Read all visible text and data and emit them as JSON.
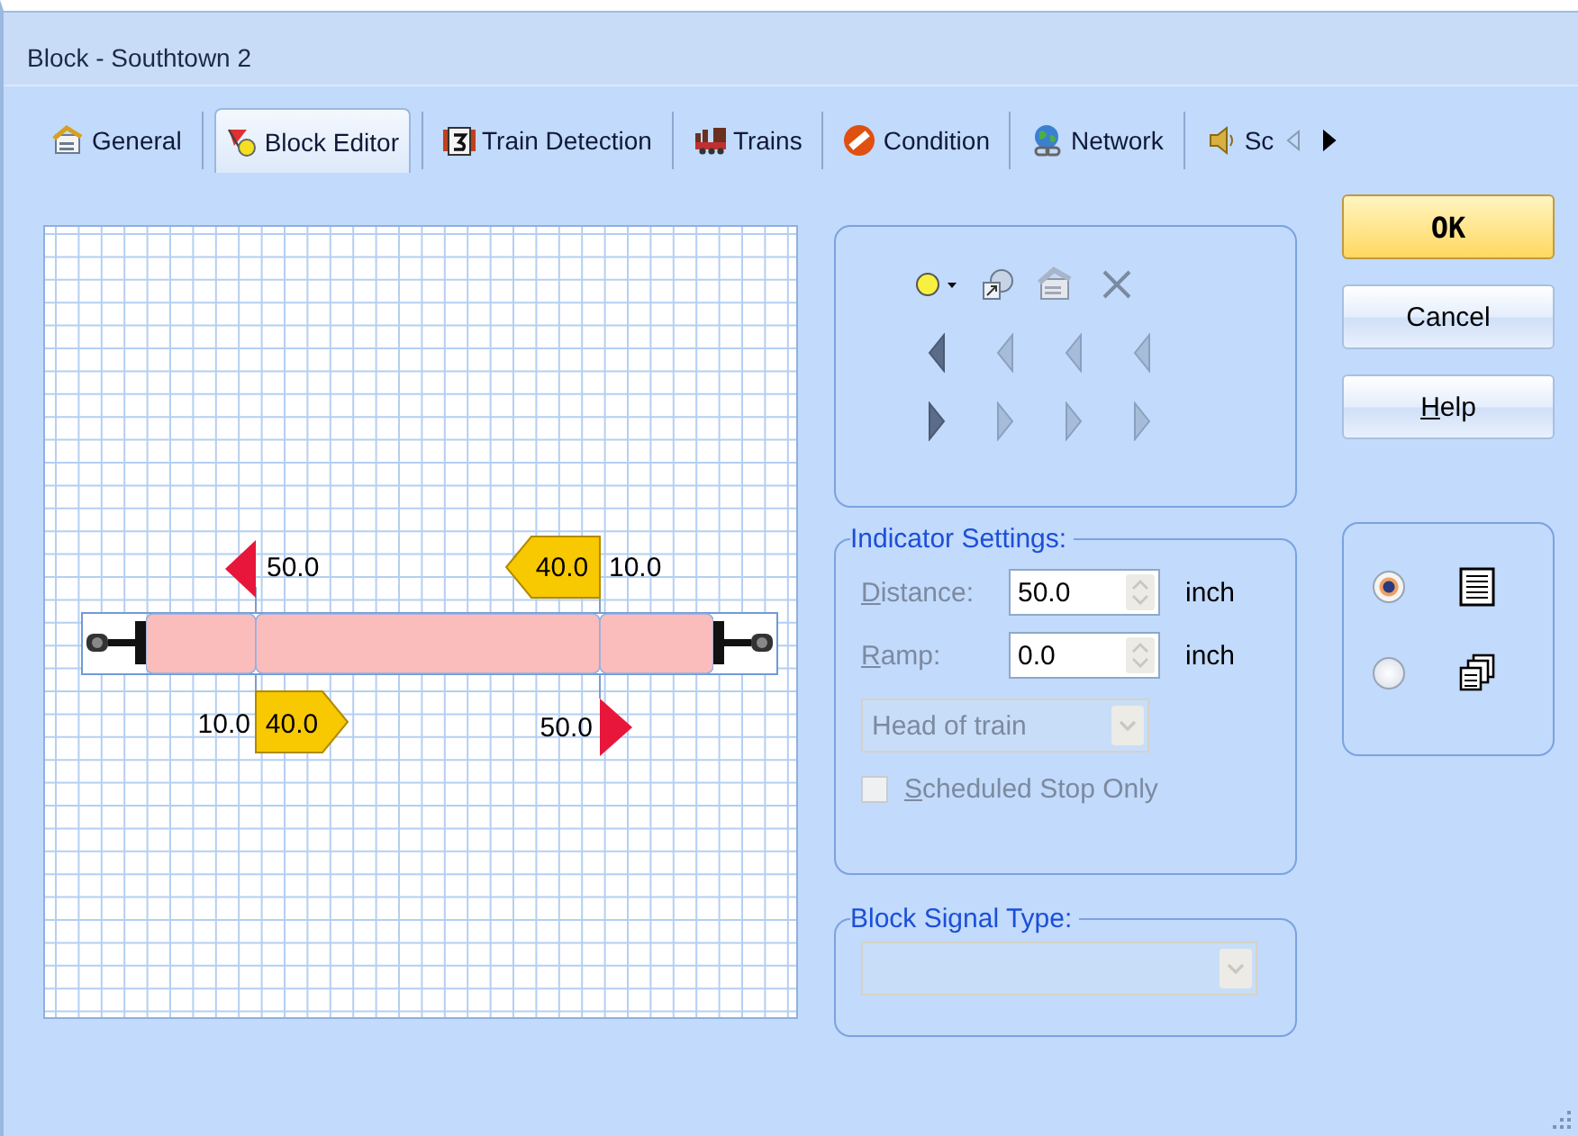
{
  "window": {
    "title": "Block - Southtown 2"
  },
  "tabs": [
    {
      "label": "General",
      "selected": false
    },
    {
      "label": "Block Editor",
      "selected": true
    },
    {
      "label": "Train Detection",
      "selected": false
    },
    {
      "label": "Trains",
      "selected": false
    },
    {
      "label": "Condition",
      "selected": false
    },
    {
      "label": "Network",
      "selected": false
    },
    {
      "label": "Sc",
      "selected": false
    }
  ],
  "tab_scroll": {
    "left_disabled": true,
    "right_disabled": false
  },
  "diagram": {
    "indicators": [
      {
        "kind": "stop",
        "below": false,
        "distance": "50.0"
      },
      {
        "kind": "speed",
        "below": false,
        "speed": "40.0",
        "distance": "10.0"
      },
      {
        "kind": "speed",
        "below": true,
        "speed": "40.0",
        "distance": "10.0"
      },
      {
        "kind": "stop",
        "below": true,
        "distance": "50.0"
      }
    ]
  },
  "toolbox": {
    "left_arrows": [
      {
        "disabled": false
      },
      {
        "disabled": true
      },
      {
        "disabled": true
      },
      {
        "disabled": true
      }
    ],
    "right_arrows": [
      {
        "disabled": false
      },
      {
        "disabled": true
      },
      {
        "disabled": true
      },
      {
        "disabled": true
      }
    ]
  },
  "indicator_settings": {
    "title": "Indicator Settings:",
    "disabled": true,
    "fields": [
      {
        "label": "Distance:",
        "value": "50.0",
        "unit": "inch"
      },
      {
        "label": "Ramp:",
        "value": "0.0",
        "unit": "inch"
      }
    ],
    "position": {
      "value": "Head of train",
      "disabled": true
    },
    "scheduled_stop": {
      "label": "Scheduled Stop Only",
      "checked": false,
      "disabled": true
    }
  },
  "block_signal_type": {
    "title": "Block Signal Type:",
    "disabled": true
  },
  "buttons": [
    {
      "label": "OK",
      "kind": "default"
    },
    {
      "label": "Cancel",
      "kind": "normal"
    },
    {
      "label": "Help",
      "kind": "mnemonic"
    }
  ],
  "view_options": [
    {
      "selected": true
    },
    {
      "selected": false
    }
  ]
}
